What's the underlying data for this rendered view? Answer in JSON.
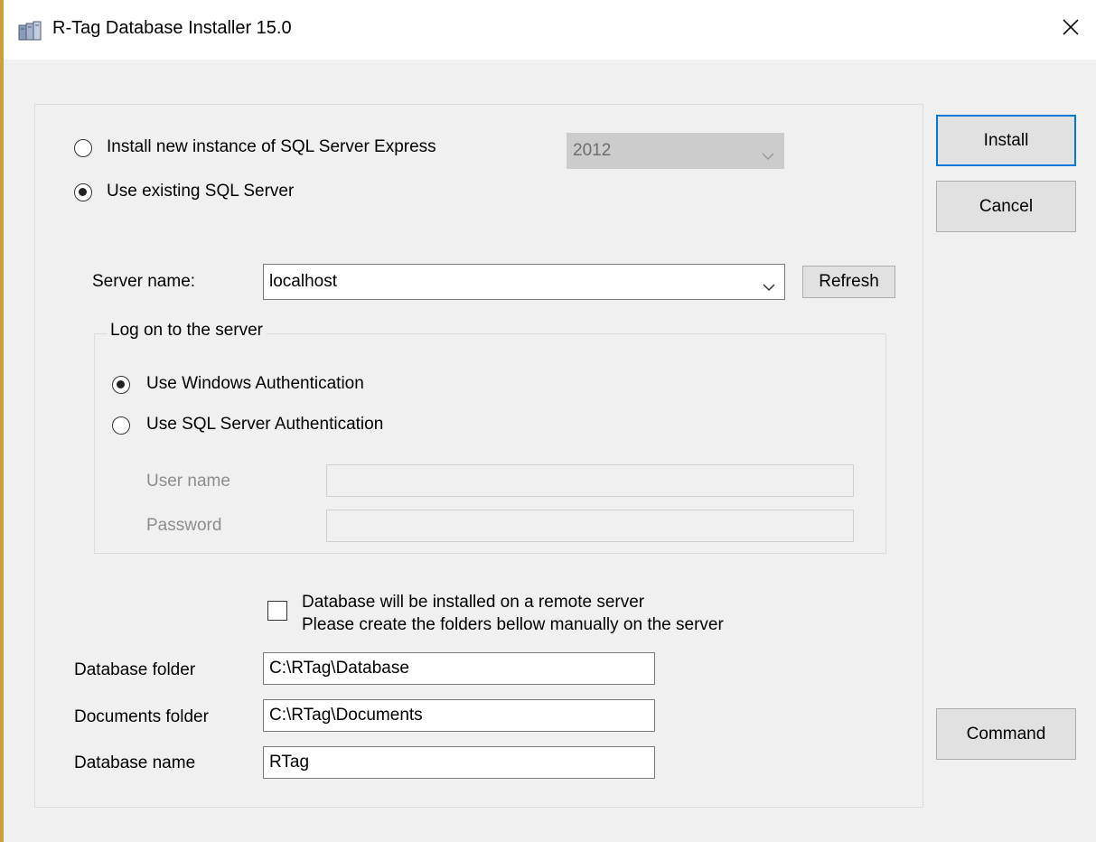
{
  "window": {
    "title": "R-Tag Database Installer 15.0",
    "close_glyph": "✕"
  },
  "install_options": {
    "new_instance_label": "Install new instance of SQL Server Express",
    "new_instance_checked": false,
    "version_select_value": "2012",
    "existing_label": "Use existing SQL Server",
    "existing_checked": true
  },
  "server": {
    "label": "Server name:",
    "value": "localhost",
    "refresh_label": "Refresh"
  },
  "logon": {
    "group_label": "Log on to the server",
    "windows_auth_label": "Use Windows Authentication",
    "windows_auth_checked": true,
    "sql_auth_label": "Use SQL Server Authentication",
    "sql_auth_checked": false,
    "username_label": "User name",
    "username_value": "",
    "password_label": "Password",
    "password_value": ""
  },
  "remote": {
    "checked": false,
    "line1": "Database will be installed on a remote server",
    "line2": "Please create the folders bellow manually on the server"
  },
  "folders": {
    "database_folder_label": "Database folder",
    "database_folder_value": "C:\\RTag\\Database",
    "documents_folder_label": "Documents folder",
    "documents_folder_value": "C:\\RTag\\Documents",
    "database_name_label": "Database name",
    "database_name_value": "RTag"
  },
  "buttons": {
    "install": "Install",
    "cancel": "Cancel",
    "command": "Command"
  },
  "colors": {
    "window_border": "#c8a03c",
    "default_button_border": "#0078d7",
    "dialog_background": "#f0f0f0"
  }
}
